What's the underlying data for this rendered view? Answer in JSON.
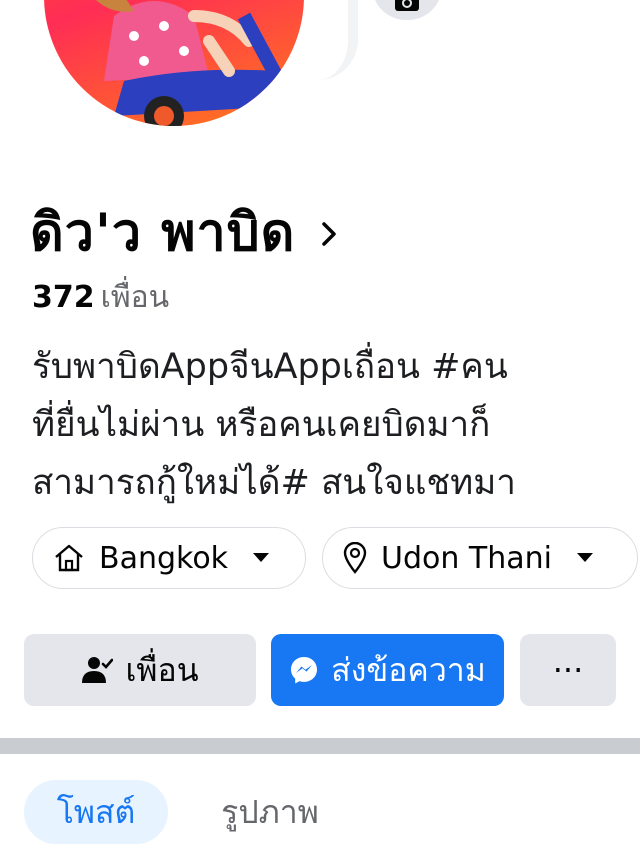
{
  "profile": {
    "name": "ดิว'ว พาบิด",
    "friends_count": "372",
    "friends_label": "เพื่อน",
    "bio_lines": [
      "รับพาบิดAppจีนAppเถื่อน #คน",
      "ที่ยื่นไม่ผ่าน หรือคนเคยบิดมาก็",
      "สามารถกู้ใหม่ได้# สนใจแชทมา"
    ]
  },
  "locations": {
    "home": "Bangkok",
    "from": "Udon Thani"
  },
  "actions": {
    "friends_label": "เพื่อน",
    "message_label": "ส่งข้อความ",
    "more_label": "···"
  },
  "tabs": [
    {
      "label": "โพสต์"
    },
    {
      "label": "รูปภาพ"
    }
  ],
  "colors": {
    "accent": "#1877f2",
    "button_gray": "#e4e6eb",
    "tab_active_bg": "#e7f3ff"
  },
  "icons": {
    "camera": "camera-icon",
    "chevron": "chevron-right-icon",
    "home": "home-icon",
    "pin": "location-pin-icon",
    "caret": "caret-down-icon",
    "friend": "friend-check-icon",
    "messenger": "messenger-icon"
  }
}
